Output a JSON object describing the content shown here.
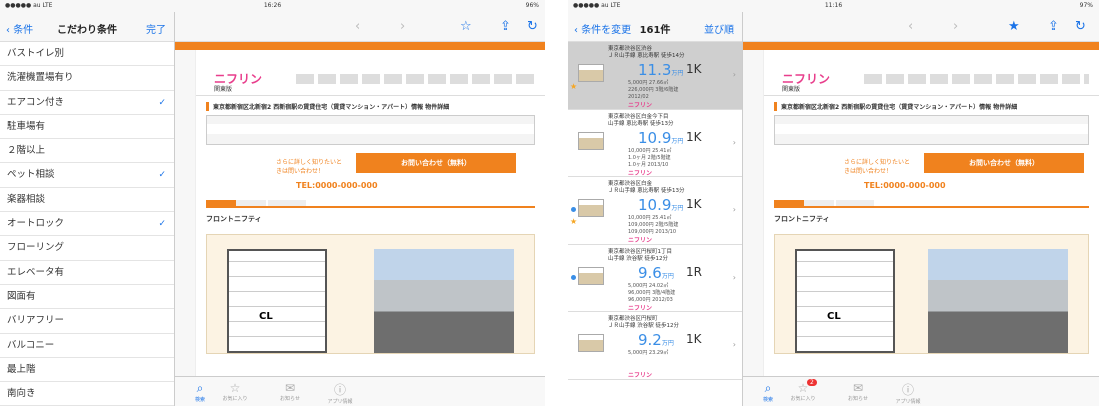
{
  "left": {
    "status": {
      "carrier": "●●●●● au  LTE",
      "time": "16:26",
      "battery": "96%"
    },
    "sidebar": {
      "back": "条件",
      "title": "こだわり条件",
      "action": "完了"
    },
    "conditions": [
      {
        "label": "バストイレ別",
        "checked": false
      },
      {
        "label": "洗濯機置場有り",
        "checked": false
      },
      {
        "label": "エアコン付き",
        "checked": true
      },
      {
        "label": "駐車場有",
        "checked": false
      },
      {
        "label": "２階以上",
        "checked": false
      },
      {
        "label": "ペット相談",
        "checked": true
      },
      {
        "label": "楽器相談",
        "checked": false
      },
      {
        "label": "オートロック",
        "checked": true
      },
      {
        "label": "フローリング",
        "checked": false
      },
      {
        "label": "エレベータ有",
        "checked": false
      },
      {
        "label": "図面有",
        "checked": false
      },
      {
        "label": "バリアフリー",
        "checked": false
      },
      {
        "label": "バルコニー",
        "checked": false
      },
      {
        "label": "最上階",
        "checked": false
      },
      {
        "label": "南向き",
        "checked": false
      }
    ]
  },
  "right": {
    "status": {
      "carrier": "●●●●● au  LTE",
      "time": "11:16",
      "battery": "97%"
    },
    "sidebar": {
      "back": "条件を変更",
      "count": "161件",
      "action": "並び順"
    },
    "listings": [
      {
        "addr": "東京都渋谷区渋谷\nＪＲ山手線 恵比寿駅 徒歩14分",
        "rent": "11.3",
        "unit": "万円",
        "layout": "1K",
        "meta": "5,000円  27.66㎡\n226,000円  3階/6階建\n2012/02",
        "selected": true,
        "star": true,
        "dot": false
      },
      {
        "addr": "東京都渋谷区白金今下目\n山手線 恵比寿駅 徒歩13分",
        "rent": "10.9",
        "unit": "万円",
        "layout": "1K",
        "meta": "10,000円  25.41㎡\n1.0ヶ月  2階/5階建\n1.0ヶ月  2013/10",
        "selected": false,
        "star": false,
        "dot": false
      },
      {
        "addr": "東京都渋谷区白金\nＪＲ山手線 恵比寿駅 徒歩13分",
        "rent": "10.9",
        "unit": "万円",
        "layout": "1K",
        "meta": "10,000円  25.41㎡\n109,000円  2階/5階建\n109,000円  2013/10",
        "selected": false,
        "star": true,
        "dot": true
      },
      {
        "addr": "東京都渋谷区円桜町1丁目\n山手線 渋谷駅 徒歩12分",
        "rent": "9.6",
        "unit": "万円",
        "layout": "1R",
        "meta": "5,000円  24.02㎡\n96,000円  3階/4階建\n96,000円  2012/03",
        "selected": false,
        "star": false,
        "dot": true
      },
      {
        "addr": "東京都渋谷区円桜町\nＪＲ山手線 渋谷駅 徒歩12分",
        "rent": "9.2",
        "unit": "万円",
        "layout": "1K",
        "meta": "5,000円  23.29㎡",
        "selected": false,
        "star": false,
        "dot": false
      }
    ],
    "badge": "2"
  },
  "web": {
    "logo": "ニフリン",
    "region": "関東版",
    "heading": "東京都新宿区北新宿2 西新宿駅の賃貸住宅（賃貸マンション・アパート）情報 物件詳細",
    "cta_text": "さらに詳しく知りたいときは問い合わせ！",
    "cta_button": "お問い合わせ（無料）",
    "tel": "TEL:0000-000-000",
    "building": "フロントニフティ",
    "floorplan_label": "CL"
  },
  "tabbar": [
    "検索",
    "お気に入り",
    "お知らせ",
    "アプリ情報"
  ]
}
